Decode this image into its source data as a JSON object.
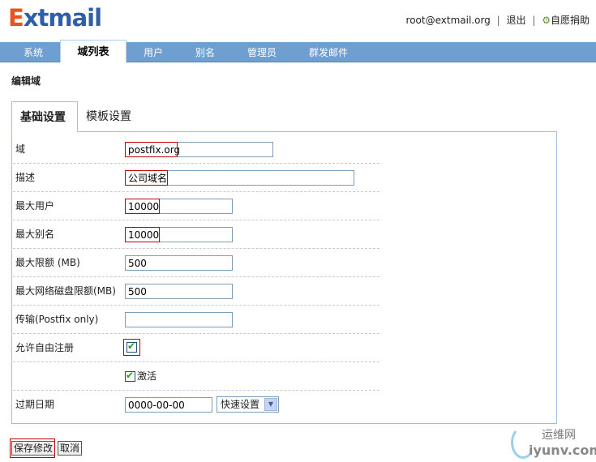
{
  "header": {
    "logo_e": "E",
    "logo_rest": "xtmail",
    "user": "root@extmail.org",
    "sep1": "|",
    "logout": "退出",
    "sep2": "|",
    "donate_icon": "gear-icon",
    "donate": "自愿捐助"
  },
  "nav": {
    "items": [
      {
        "label": "系统"
      },
      {
        "label": "域列表"
      },
      {
        "label": "用户"
      },
      {
        "label": "别名"
      },
      {
        "label": "管理员"
      },
      {
        "label": "群发邮件"
      }
    ],
    "active_index": 1
  },
  "page_title": "编辑域",
  "tabs": [
    {
      "label": "基础设置",
      "active": true
    },
    {
      "label": "模板设置",
      "active": false
    }
  ],
  "form": {
    "domain_label": "域",
    "domain_value": "postfix.org",
    "desc_label": "描述",
    "desc_value": "公司域名",
    "max_users_label": "最大用户",
    "max_users_value": "10000",
    "max_alias_label": "最大别名",
    "max_alias_value": "10000",
    "quota_label": "最大限额 (MB)",
    "quota_value": "500",
    "netdisk_label": "最大网络磁盘限额(MB)",
    "netdisk_value": "500",
    "transport_label": "传输(Postfix only)",
    "transport_value": "",
    "signup_label": "允许自由注册",
    "signup_checked": true,
    "active_label": "激活",
    "active_checked": true,
    "expire_label": "过期日期",
    "expire_value": "0000-00-00",
    "quick_set": "快速设置"
  },
  "buttons": {
    "save": "保存修改",
    "cancel": "取消"
  },
  "watermark": {
    "line1": "运维网",
    "line2": "iyunv.com"
  },
  "colors": {
    "nav_bg": "#6f9fd1",
    "highlight": "#c00000",
    "logo_orange": "#e8541e",
    "logo_blue": "#2f5fa8"
  }
}
